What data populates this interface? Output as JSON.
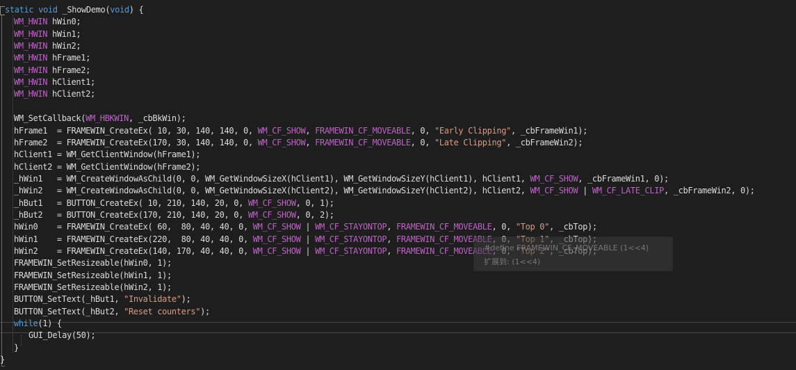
{
  "editor": {
    "tooltip": {
      "line1": "#define FRAMEWIN_CF_MOVEABLE (1<<4)",
      "line2": "扩展到: (1<<4)"
    },
    "lines": [
      [
        {
          "t": "static void ",
          "c": "kw"
        },
        {
          "t": "_ShowDemo(",
          "c": "plain"
        },
        {
          "t": "void",
          "c": "kw"
        },
        {
          "t": ") {",
          "c": "plain"
        }
      ],
      [
        {
          "t": "WM_HWIN",
          "c": "macro"
        },
        {
          "t": " hWin0;",
          "c": "plain"
        }
      ],
      [
        {
          "t": "WM_HWIN",
          "c": "macro"
        },
        {
          "t": " hWin1;",
          "c": "plain"
        }
      ],
      [
        {
          "t": "WM_HWIN",
          "c": "macro"
        },
        {
          "t": " hWin2;",
          "c": "plain"
        }
      ],
      [
        {
          "t": "WM_HWIN",
          "c": "macro"
        },
        {
          "t": " hFrame1;",
          "c": "plain"
        }
      ],
      [
        {
          "t": "WM_HWIN",
          "c": "macro"
        },
        {
          "t": " hFrame2;",
          "c": "plain"
        }
      ],
      [
        {
          "t": "WM_HWIN",
          "c": "macro"
        },
        {
          "t": " hClient1;",
          "c": "plain"
        }
      ],
      [
        {
          "t": "WM_HWIN",
          "c": "macro"
        },
        {
          "t": " hClient2;",
          "c": "plain"
        }
      ],
      [],
      [
        {
          "t": "WM_SetCallback(",
          "c": "plain"
        },
        {
          "t": "WM_HBKWIN",
          "c": "macro"
        },
        {
          "t": ", _cbBkWin);",
          "c": "plain"
        }
      ],
      [
        {
          "t": "hFrame1  = FRAMEWIN_CreateEx( 10, 30, 140, 140, 0, ",
          "c": "plain"
        },
        {
          "t": "WM_CF_SHOW",
          "c": "macro"
        },
        {
          "t": ", ",
          "c": "plain"
        },
        {
          "t": "FRAMEWIN_CF_MOVEABLE",
          "c": "macro"
        },
        {
          "t": ", 0, ",
          "c": "plain"
        },
        {
          "t": "\"Early Clipping\"",
          "c": "str"
        },
        {
          "t": ", _cbFrameWin1);",
          "c": "plain"
        }
      ],
      [
        {
          "t": "hFrame2  = FRAMEWIN_CreateEx(170, 30, 140, 140, 0, ",
          "c": "plain"
        },
        {
          "t": "WM_CF_SHOW",
          "c": "macro"
        },
        {
          "t": ", ",
          "c": "plain"
        },
        {
          "t": "FRAMEWIN_CF_MOVEABLE",
          "c": "macro"
        },
        {
          "t": ", 0, ",
          "c": "plain"
        },
        {
          "t": "\"Late Clipping\"",
          "c": "str"
        },
        {
          "t": ", _cbFrameWin2);",
          "c": "plain"
        }
      ],
      [
        {
          "t": "hClient1 = WM_GetClientWindow(hFrame1);",
          "c": "plain"
        }
      ],
      [
        {
          "t": "hClient2 = WM_GetClientWindow(hFrame2);",
          "c": "plain"
        }
      ],
      [
        {
          "t": "_hWin1   = WM_CreateWindowAsChild(0, 0, WM_GetWindowSizeX(hClient1), WM_GetWindowSizeY(hClient1), hClient1, ",
          "c": "plain"
        },
        {
          "t": "WM_CF_SHOW",
          "c": "macro"
        },
        {
          "t": ", _cbFrameWin1, 0);",
          "c": "plain"
        }
      ],
      [
        {
          "t": "_hWin2   = WM_CreateWindowAsChild(0, 0, WM_GetWindowSizeX(hClient2), WM_GetWindowSizeY(hClient2), hClient2, ",
          "c": "plain"
        },
        {
          "t": "WM_CF_SHOW",
          "c": "macro"
        },
        {
          "t": " | ",
          "c": "plain"
        },
        {
          "t": "WM_CF_LATE_CLIP",
          "c": "macro"
        },
        {
          "t": ", _cbFrameWin2, 0);",
          "c": "plain"
        }
      ],
      [
        {
          "t": "_hBut1   = BUTTON_CreateEx( 10, 210, 140, 20, 0, ",
          "c": "plain"
        },
        {
          "t": "WM_CF_SHOW",
          "c": "macro"
        },
        {
          "t": ", 0, 1);",
          "c": "plain"
        }
      ],
      [
        {
          "t": "_hBut2   = BUTTON_CreateEx(170, 210, 140, 20, 0, ",
          "c": "plain"
        },
        {
          "t": "WM_CF_SHOW",
          "c": "macro"
        },
        {
          "t": ", 0, 2);",
          "c": "plain"
        }
      ],
      [
        {
          "t": "hWin0    = FRAMEWIN_CreateEx( 60,  80, 40, 40, 0, ",
          "c": "plain"
        },
        {
          "t": "WM_CF_SHOW",
          "c": "macro"
        },
        {
          "t": " | ",
          "c": "plain"
        },
        {
          "t": "WM_CF_STAYONTOP",
          "c": "macro"
        },
        {
          "t": ", ",
          "c": "plain"
        },
        {
          "t": "FRAMEWIN_CF_MOVEABLE",
          "c": "macro"
        },
        {
          "t": ", 0, ",
          "c": "plain"
        },
        {
          "t": "\"Top 0\"",
          "c": "str"
        },
        {
          "t": ", _cbTop);",
          "c": "plain"
        }
      ],
      [
        {
          "t": "hWin1    = FRAMEWIN_CreateEx(220,  80, 40, 40, 0, ",
          "c": "plain"
        },
        {
          "t": "WM_CF_SHOW",
          "c": "macro"
        },
        {
          "t": " | ",
          "c": "plain"
        },
        {
          "t": "WM_CF_STAYONTOP",
          "c": "macro"
        },
        {
          "t": ", ",
          "c": "plain"
        },
        {
          "t": "FRAMEWIN_CF_MOVEABLE",
          "c": "macro"
        },
        {
          "t": ", 0, ",
          "c": "plain"
        },
        {
          "t": "\"Top 1\"",
          "c": "str"
        },
        {
          "t": ", _cbTop);",
          "c": "plain"
        }
      ],
      [
        {
          "t": "hWin2    = FRAMEWIN_CreateEx(140, 170, 40, 40, 0, ",
          "c": "plain"
        },
        {
          "t": "WM_CF_SHOW",
          "c": "macro"
        },
        {
          "t": " | ",
          "c": "plain"
        },
        {
          "t": "WM_CF_STAYONTOP",
          "c": "macro"
        },
        {
          "t": ", ",
          "c": "plain"
        },
        {
          "t": "FRAMEWIN_CF_MOVEABLE",
          "c": "macro"
        },
        {
          "t": ", 0, ",
          "c": "plain"
        },
        {
          "t": "\"Top 2\"",
          "c": "str"
        },
        {
          "t": ", _cbTop);",
          "c": "plain"
        }
      ],
      [
        {
          "t": "FRAMEWIN_SetResizeable(hWin0, 1);",
          "c": "plain"
        }
      ],
      [
        {
          "t": "FRAMEWIN_SetResizeable(hWin1, 1);",
          "c": "plain"
        }
      ],
      [
        {
          "t": "FRAMEWIN_SetResizeable(hWin2, 1);",
          "c": "plain"
        }
      ],
      [
        {
          "t": "BUTTON_SetText(_hBut1, ",
          "c": "plain"
        },
        {
          "t": "\"Invalidate\"",
          "c": "str"
        },
        {
          "t": ");",
          "c": "plain"
        }
      ],
      [
        {
          "t": "BUTTON_SetText(_hBut2, ",
          "c": "plain"
        },
        {
          "t": "\"Reset counters\"",
          "c": "str"
        },
        {
          "t": ");",
          "c": "plain"
        }
      ],
      [
        {
          "t": "while",
          "c": "kw"
        },
        {
          "t": "(1) {",
          "c": "plain"
        }
      ],
      [
        {
          "t": "GUI_Delay(50);",
          "c": "plain"
        }
      ],
      [
        {
          "t": "}",
          "c": "plain"
        }
      ],
      [
        {
          "t": "}",
          "c": "plain"
        }
      ]
    ]
  }
}
